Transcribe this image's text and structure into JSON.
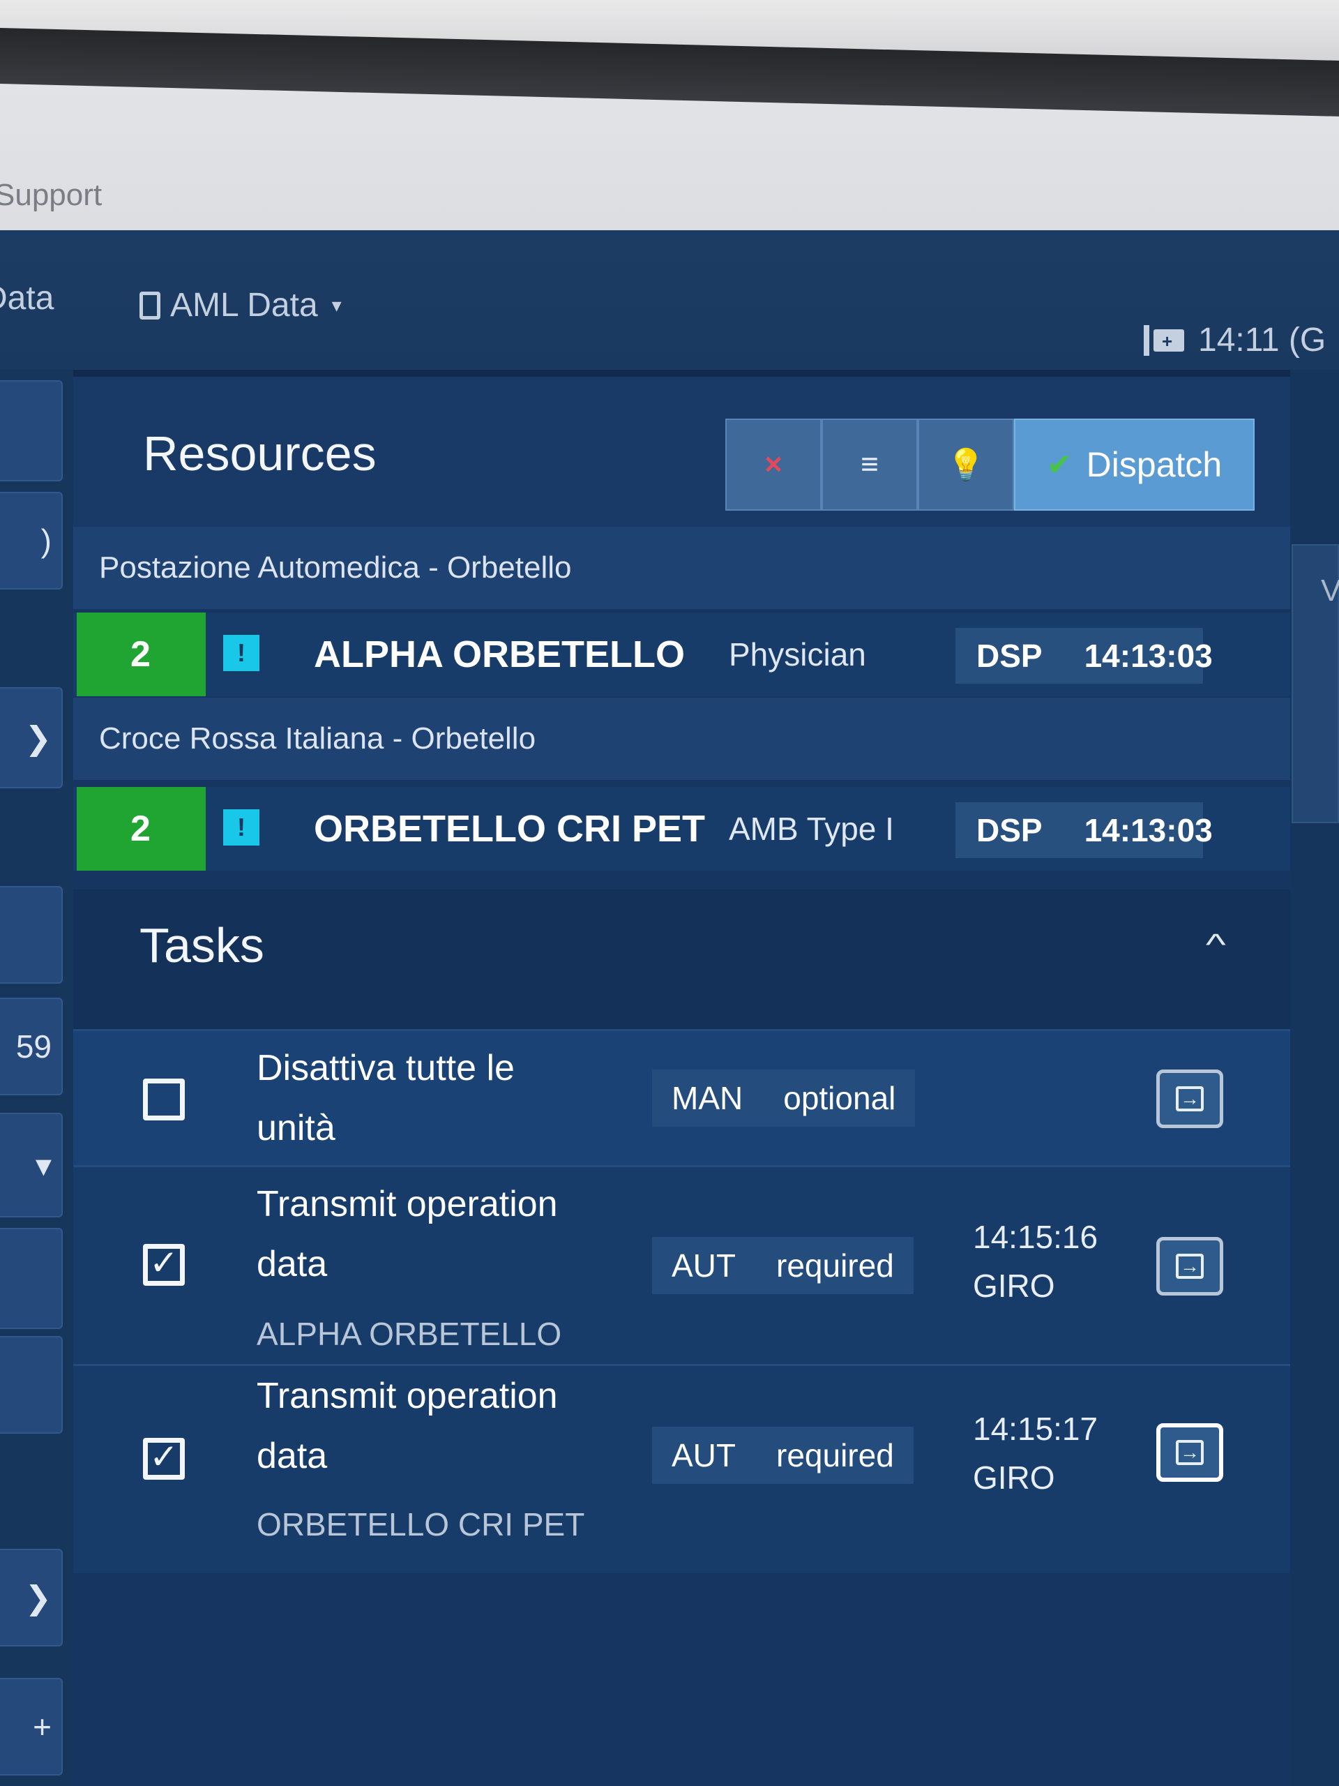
{
  "header": {
    "support_label": "Support",
    "nav_data_partial": "Data",
    "nav_aml_data": "AML Data",
    "clock_partial": "14:11 (G"
  },
  "sidebar": {
    "items": [
      "",
      ")",
      "",
      "",
      "",
      "59",
      "",
      "",
      "",
      "",
      "+"
    ]
  },
  "resources": {
    "title": "Resources",
    "toolbar": {
      "close_icon": "×",
      "list_icon": "≡",
      "bulb_icon": "💡",
      "dispatch_label": "Dispatch",
      "dispatch_check": "✔"
    },
    "groups": [
      {
        "label": "Postazione Automedica - Orbetello",
        "resource": {
          "count": "2",
          "flag": "!",
          "name": "ALPHA ORBETELLO",
          "type": "Physician",
          "status": "DSP",
          "time": "14:13:03"
        }
      },
      {
        "label": "Croce Rossa Italiana - Orbetello",
        "resource": {
          "count": "2",
          "flag": "!",
          "name": "ORBETELLO CRI PET",
          "type": "AMB Type I",
          "status": "DSP",
          "time": "14:13:03"
        }
      }
    ]
  },
  "tasks": {
    "title": "Tasks",
    "collapse_icon": "^",
    "items": [
      {
        "title": "Disattiva tutte le unità",
        "subtitle": "",
        "checked": false,
        "mode": "MAN",
        "requirement": "optional",
        "time": "",
        "user": ""
      },
      {
        "title": "Transmit operation data",
        "subtitle": "ALPHA ORBETELLO",
        "checked": true,
        "mode": "AUT",
        "requirement": "required",
        "time": "14:15:16",
        "user": "GIRO"
      },
      {
        "title": "Transmit operation data",
        "subtitle": "ORBETELLO CRI PET",
        "checked": true,
        "mode": "AUT",
        "requirement": "required",
        "time": "14:15:17",
        "user": "GIRO"
      }
    ]
  },
  "right_tab": {
    "label": "V"
  },
  "colors": {
    "resource_count_bg": "#21a532",
    "resource_flag_bg": "#19c8e8",
    "dispatch_bg": "#5b9bd3",
    "close_icon": "#e24a5c",
    "bulb_icon": "#f2cf2a"
  }
}
